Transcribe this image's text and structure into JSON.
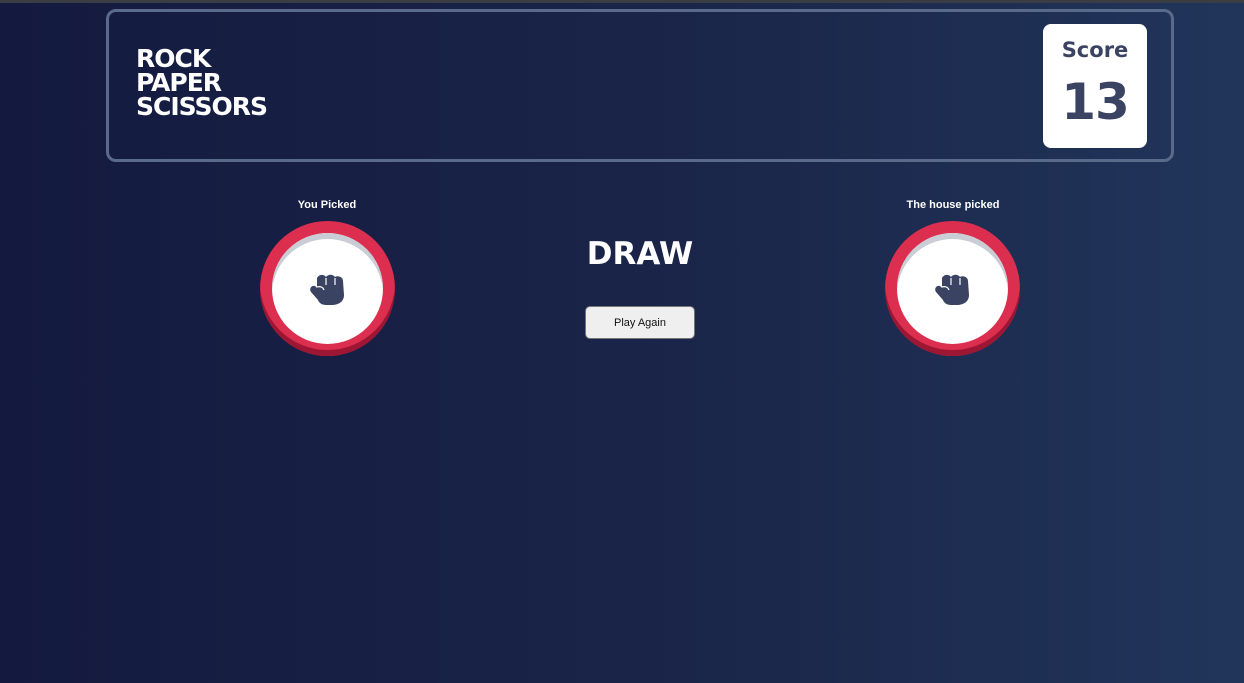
{
  "header": {
    "title_lines": [
      "ROCK",
      "PAPER",
      "SCISSORS"
    ],
    "score_label": "Score",
    "score_value": "13"
  },
  "player": {
    "label": "You Picked",
    "choice": "rock",
    "icon": "rock-icon",
    "ring_color": "#dc2e4e"
  },
  "house": {
    "label": "The house picked",
    "choice": "rock",
    "icon": "rock-icon",
    "ring_color": "#dc2e4e"
  },
  "result": {
    "text": "DRAW",
    "play_again_label": "Play Again"
  },
  "colors": {
    "background": "#141a3f",
    "outline": "#5a6a8a",
    "dark_text": "#3b4363",
    "rock_red": "#dc2e4e"
  }
}
